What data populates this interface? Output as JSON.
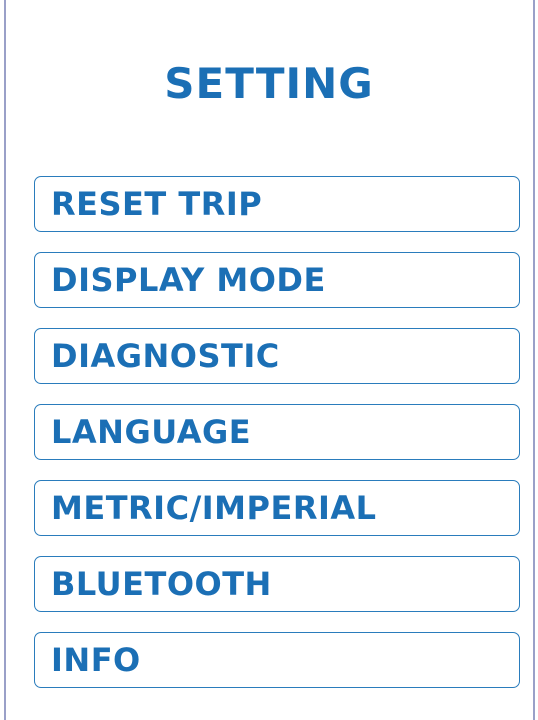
{
  "screen": {
    "title": "SETTING",
    "colors": {
      "accent": "#1b6fb5",
      "border": "#2a7cbc",
      "background": "#ffffff"
    }
  },
  "menu": {
    "items": [
      {
        "label": "RESET TRIP"
      },
      {
        "label": "DISPLAY MODE"
      },
      {
        "label": "DIAGNOSTIC"
      },
      {
        "label": "LANGUAGE"
      },
      {
        "label": "METRIC/IMPERIAL"
      },
      {
        "label": "BLUETOOTH"
      },
      {
        "label": "INFO"
      }
    ]
  }
}
